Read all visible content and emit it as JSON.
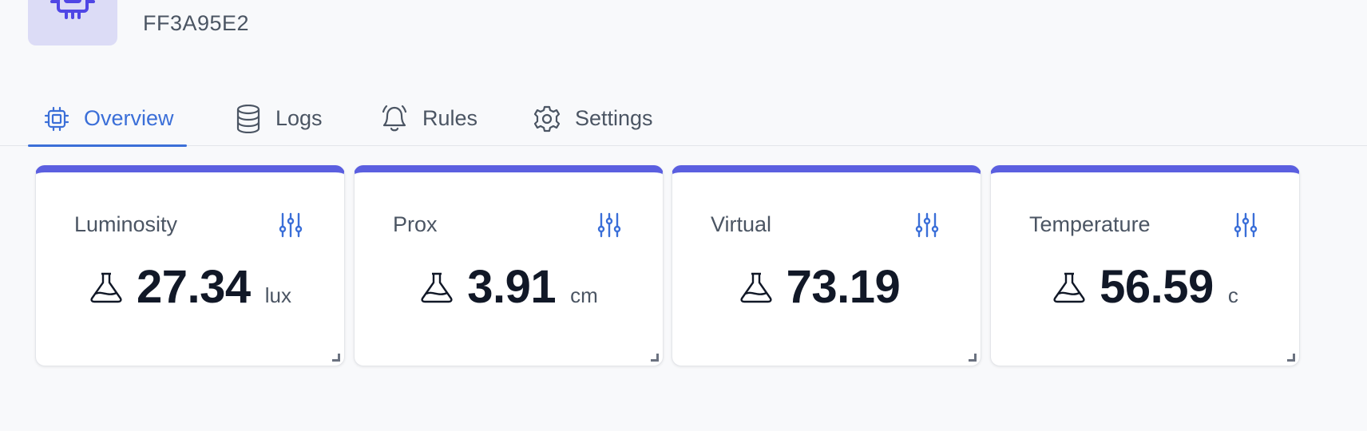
{
  "device": {
    "id": "FF3A95E2"
  },
  "tabs": [
    {
      "label": "Overview",
      "icon": "cpu-icon",
      "active": true
    },
    {
      "label": "Logs",
      "icon": "database-icon",
      "active": false
    },
    {
      "label": "Rules",
      "icon": "bell-icon",
      "active": false
    },
    {
      "label": "Settings",
      "icon": "gear-icon",
      "active": false
    }
  ],
  "cards": [
    {
      "label": "Luminosity",
      "value": "27.34",
      "unit": "lux"
    },
    {
      "label": "Prox",
      "value": "3.91",
      "unit": "cm"
    },
    {
      "label": "Virtual",
      "value": "73.19",
      "unit": ""
    },
    {
      "label": "Temperature",
      "value": "56.59",
      "unit": "c"
    }
  ],
  "colors": {
    "accent": "#3b6fd8",
    "card_top_border": "#5b5fe0",
    "icon_box_bg": "#dcdcf6",
    "page_bg": "#f8f9fb"
  }
}
